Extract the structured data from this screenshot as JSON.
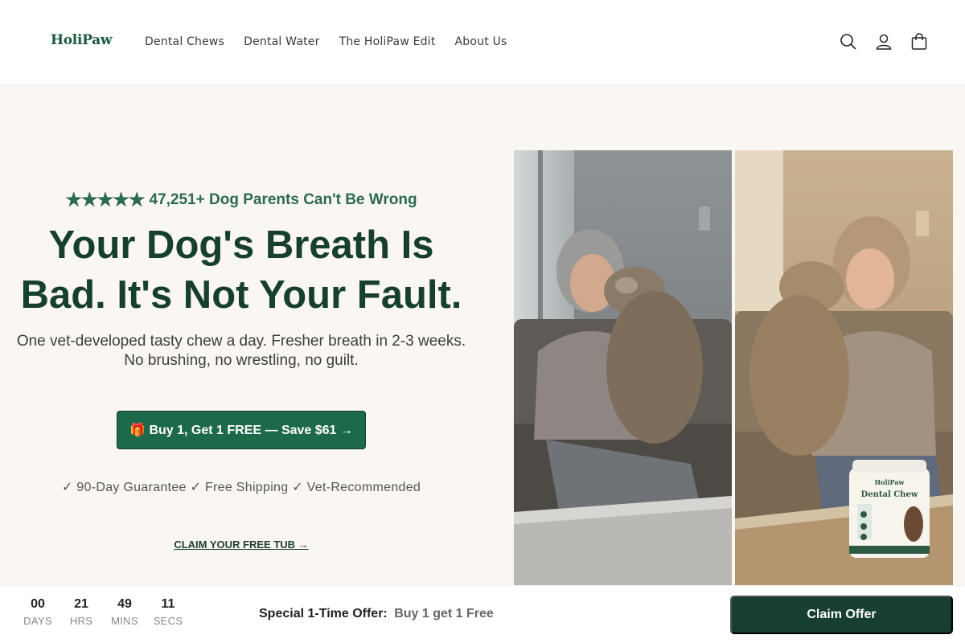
{
  "header": {
    "logo": "HoliPaw",
    "nav": [
      {
        "label": "Dental Chews"
      },
      {
        "label": "Dental Water"
      },
      {
        "label": "The HoliPaw Edit"
      },
      {
        "label": "About Us"
      }
    ],
    "icons": [
      "search-icon",
      "account-icon",
      "cart-icon"
    ]
  },
  "hero": {
    "stars": "★★★★★",
    "rating_text": "47,251+ Dog Parents Can't Be Wrong",
    "headline_line1": "Your Dog's Breath Is",
    "headline_line2": "Bad. It's Not Your Fault.",
    "subtext_line1": "One vet-developed tasty chew a day. Fresher breath in 2-3 weeks.",
    "subtext_line2": "No brushing, no wrestling, no guilt.",
    "cta_label": "🎁 Buy 1, Get 1 FREE — Save $61 →",
    "trust_line": "✓ 90-Day Guarantee ✓ Free Shipping ✓ Vet-Recommended",
    "claim_link": "CLAIM YOUR FREE TUB →",
    "product_tub": {
      "brand": "HoliPaw",
      "name": "Dental Chew"
    }
  },
  "bottom_bar": {
    "countdown": [
      {
        "value": "00",
        "label": "DAYS"
      },
      {
        "value": "21",
        "label": "HRS"
      },
      {
        "value": "49",
        "label": "MINS"
      },
      {
        "value": "11",
        "label": "SECS"
      }
    ],
    "offer_label": "Special 1-Time Offer:",
    "offer_value": "Buy 1 get 1 Free",
    "claim_button": "Claim Offer"
  },
  "colors": {
    "brand_green": "#1d6a4a",
    "dark_green": "#173f2f",
    "background": "#faf7f2"
  }
}
